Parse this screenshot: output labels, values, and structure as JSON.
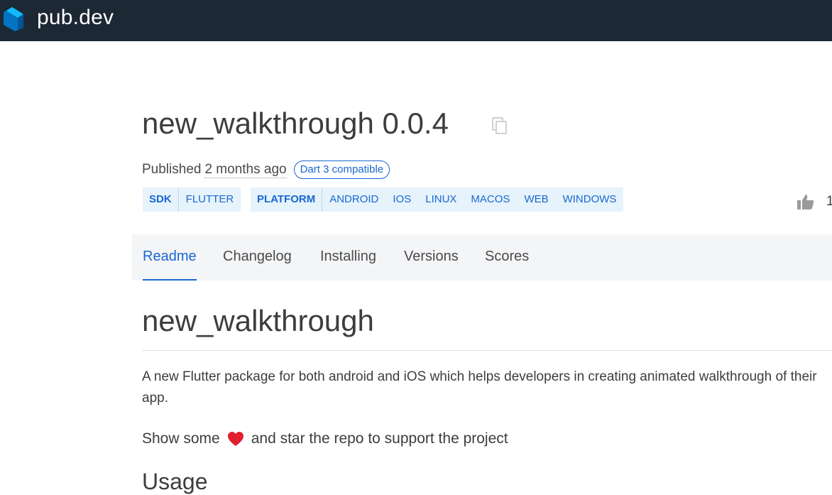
{
  "header": {
    "logo_text": "pub.dev"
  },
  "package": {
    "title": "new_walkthrough 0.0.4",
    "published_prefix": "Published",
    "published_time": "2 months ago",
    "compat_badge": "Dart 3 compatible",
    "likes": "1"
  },
  "tags": {
    "sdk_label": "SDK",
    "sdk_values": [
      "FLUTTER"
    ],
    "platform_label": "PLATFORM",
    "platform_values": [
      "ANDROID",
      "IOS",
      "LINUX",
      "MACOS",
      "WEB",
      "WINDOWS"
    ]
  },
  "tabs": [
    {
      "label": "Readme",
      "active": true
    },
    {
      "label": "Changelog",
      "active": false
    },
    {
      "label": "Installing",
      "active": false
    },
    {
      "label": "Versions",
      "active": false
    },
    {
      "label": "Scores",
      "active": false
    }
  ],
  "readme": {
    "heading": "new_walkthrough",
    "paragraph": "A new Flutter package for both android and iOS which helps developers in creating animated walkthrough of their app.",
    "support_before": "Show some",
    "support_after": "and star the repo to support the project",
    "next_heading": "Usage"
  },
  "icons": {
    "logo": "dart-logo-icon",
    "copy": "copy-icon",
    "like": "thumbs-up-icon",
    "heart": "heart-icon"
  },
  "colors": {
    "header_bg": "#1c2834",
    "accent": "#1967d2",
    "tag_bg": "#e6f3fb",
    "tabs_bg": "#f4f5f7"
  }
}
